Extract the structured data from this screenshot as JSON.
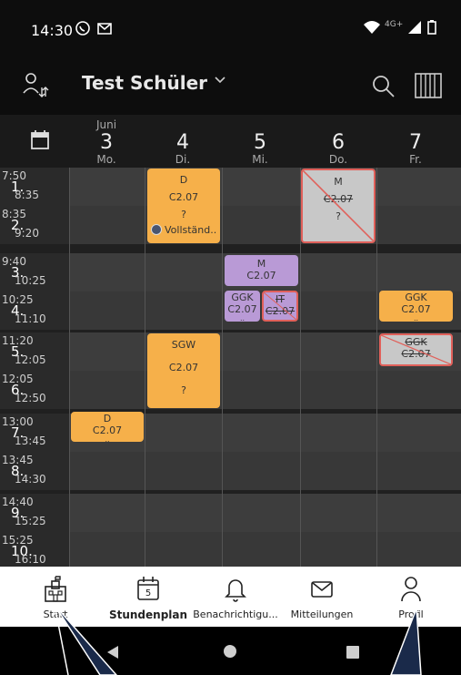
{
  "status_bar": {
    "time": "14:30",
    "network": "4G+"
  },
  "app_bar": {
    "title": "Test Schüler",
    "icons": [
      "swap-person-icon",
      "search-icon",
      "week-view-icon"
    ]
  },
  "calendar_icon": "calendar-icon",
  "days": [
    {
      "month": "Juni",
      "date": "3",
      "name": "Mo."
    },
    {
      "month": "",
      "date": "4",
      "name": "Di."
    },
    {
      "month": "",
      "date": "5",
      "name": "Mi."
    },
    {
      "month": "",
      "date": "6",
      "name": "Do."
    },
    {
      "month": "",
      "date": "7",
      "name": "Fr."
    }
  ],
  "periods": [
    {
      "start": "7:50",
      "num": "1.",
      "end": "8:35"
    },
    {
      "start": "8:35",
      "num": "2.",
      "end": "9:20"
    },
    {
      "start": "9:40",
      "num": "3.",
      "end": "10:25"
    },
    {
      "start": "10:25",
      "num": "4.",
      "end": "11:10"
    },
    {
      "start": "11:20",
      "num": "5.",
      "end": "12:05"
    },
    {
      "start": "12:05",
      "num": "6.",
      "end": "12:50"
    },
    {
      "start": "13:00",
      "num": "7.",
      "end": "13:45"
    },
    {
      "start": "13:45",
      "num": "8.",
      "end": "14:30"
    },
    {
      "start": "14:40",
      "num": "9.",
      "end": "15:25"
    },
    {
      "start": "15:25",
      "num": "10.",
      "end": "16:10"
    }
  ],
  "lessons": {
    "di_1_2": {
      "subject": "D",
      "room": "C2.07",
      "teacher": "?",
      "note": "Vollständ.."
    },
    "do_1_2": {
      "subject": "M",
      "room": "C2.07",
      "teacher": "?"
    },
    "mi_3": {
      "subject": "M",
      "room": "C2.07",
      "teacher": ""
    },
    "mi_4_a": {
      "subject": "GGK",
      "room": "C2.07",
      "teacher": ".."
    },
    "mi_4_b": {
      "subject": "IT",
      "room": "C2.07",
      "teacher": ".."
    },
    "fr_4": {
      "subject": "GGK",
      "room": "C2.07",
      "teacher": ".."
    },
    "di_5_6": {
      "subject": "SGW",
      "room": "C2.07",
      "teacher": "?"
    },
    "fr_5": {
      "subject": "GGK",
      "room": "C2.07",
      "teacher": ".."
    },
    "mo_7": {
      "subject": "D",
      "room": "C2.07",
      "teacher": ".."
    }
  },
  "nav": {
    "start": "Start",
    "stundenplan": "Stundenplan",
    "stundenplan_icon_num": "5",
    "benachrichtigungen": "Benachrichtigu...",
    "mitteilungen": "Mitteilungen",
    "profil": "Profil"
  },
  "colors": {
    "lesson_orange": "#f6b04a",
    "lesson_purple": "#b99ad6",
    "cancelled_grey": "#c8c8c8",
    "cancel_red": "#e0605a"
  }
}
